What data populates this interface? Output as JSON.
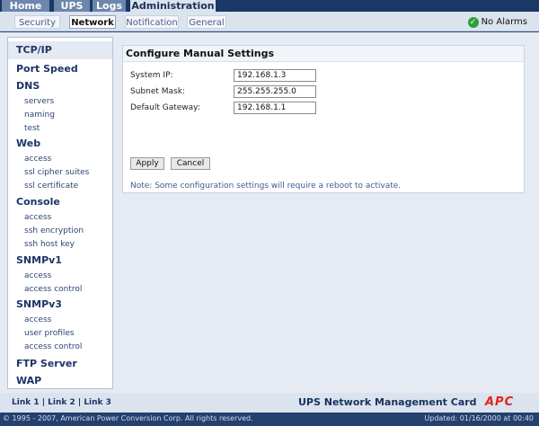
{
  "top_nav": {
    "tabs": [
      "Home",
      "UPS",
      "Logs",
      "Administration"
    ],
    "active": "Administration"
  },
  "sub_nav": {
    "tabs": [
      "Security",
      "Network",
      "Notification",
      "General"
    ],
    "active": "Network"
  },
  "status": {
    "text": "No Alarms",
    "icon": "check-circle-icon",
    "color": "#2e9e3a"
  },
  "sidebar": {
    "sections": [
      {
        "label": "TCP/IP",
        "items": []
      },
      {
        "label": "Port Speed",
        "items": []
      },
      {
        "label": "DNS",
        "items": [
          "servers",
          "naming",
          "test"
        ]
      },
      {
        "label": "Web",
        "items": [
          "access",
          "ssl cipher suites",
          "ssl certificate"
        ]
      },
      {
        "label": "Console",
        "items": [
          "access",
          "ssh encryption",
          "ssh host key"
        ]
      },
      {
        "label": "SNMPv1",
        "items": [
          "access",
          "access control"
        ]
      },
      {
        "label": "SNMPv3",
        "items": [
          "access",
          "user profiles",
          "access control"
        ]
      },
      {
        "label": "FTP Server",
        "items": []
      },
      {
        "label": "WAP",
        "items": []
      }
    ]
  },
  "content": {
    "title": "Configure Manual Settings",
    "fields": [
      {
        "label": "System IP:",
        "value": "192.168.1.3"
      },
      {
        "label": "Subnet Mask:",
        "value": "255.255.255.0"
      },
      {
        "label": "Default Gateway:",
        "value": "192.168.1.1"
      }
    ],
    "apply_label": "Apply",
    "cancel_label": "Cancel",
    "note": "Note: Some configuration settings will require a reboot to activate."
  },
  "footer": {
    "links": "Link 1 | Link 2 | Link 3",
    "product": "UPS Network Management Card",
    "logo": "APC",
    "logo_color": "#e2231a",
    "copyright": "© 1995 - 2007, American Power Conversion Corp. All rights reserved.",
    "updated": "Updated: 01/16/2000 at 00:40"
  },
  "colors": {
    "accent": "#1a3766",
    "sidebar_text": "#1c3468"
  }
}
